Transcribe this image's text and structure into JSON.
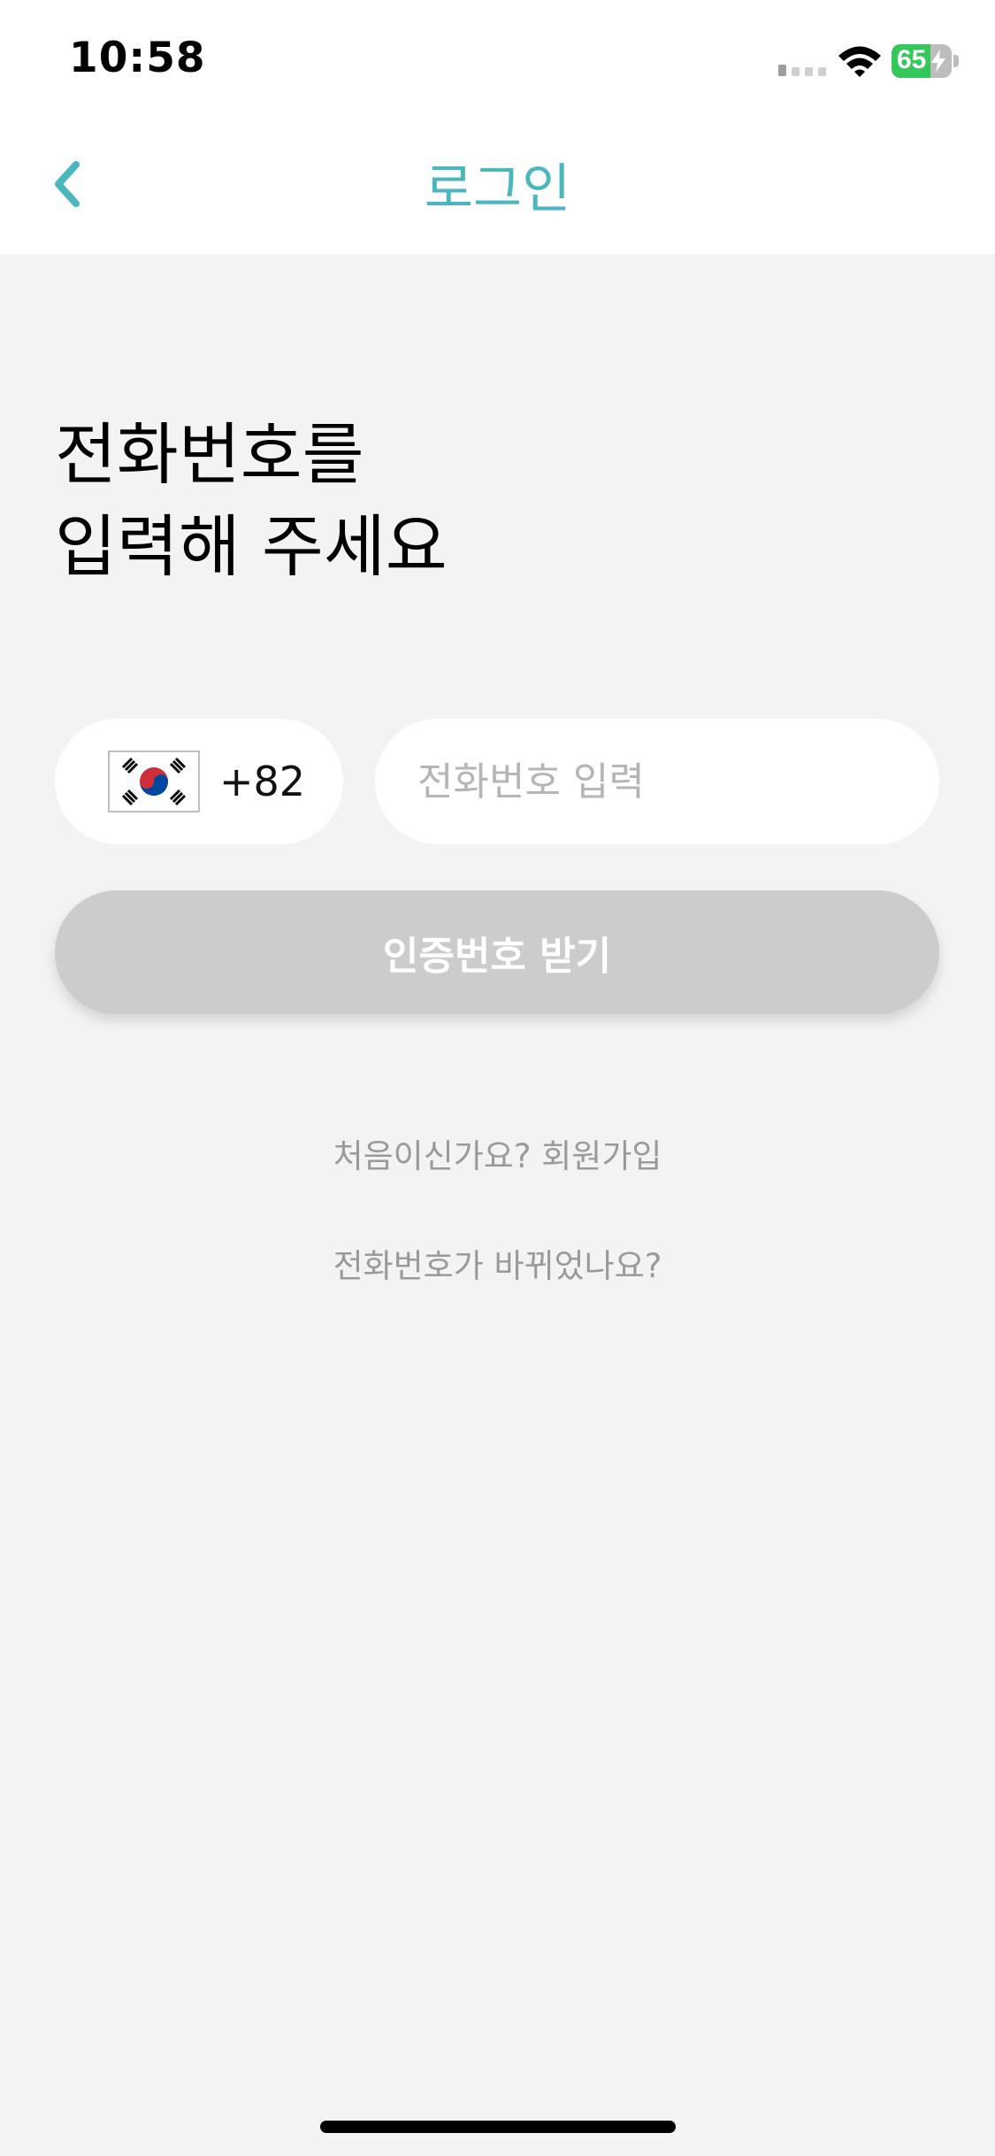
{
  "status_bar": {
    "time": "10:58",
    "battery_level": "65",
    "battery_fraction": 0.65,
    "charging": true
  },
  "nav": {
    "title": "로그인",
    "back_icon": "chevron-left-icon"
  },
  "heading": {
    "line1": "전화번호를",
    "line2": "입력해 주세요"
  },
  "phone": {
    "country_flag": "south-korea-flag-icon",
    "dial_code": "+82",
    "value": "",
    "placeholder": "전화번호 입력"
  },
  "actions": {
    "verify_label": "인증번호 받기",
    "signup_link": "처음이신가요? 회원가입",
    "changed_number_link": "전화번호가 바뀌었나요?"
  },
  "colors": {
    "accent": "#4bb7bd",
    "background": "#f3f3f3",
    "button_disabled": "#cccccc",
    "link_text": "#9a9a9a",
    "battery_green": "#34c759",
    "flag_red": "#cd2e3a",
    "flag_blue": "#0047a0"
  }
}
